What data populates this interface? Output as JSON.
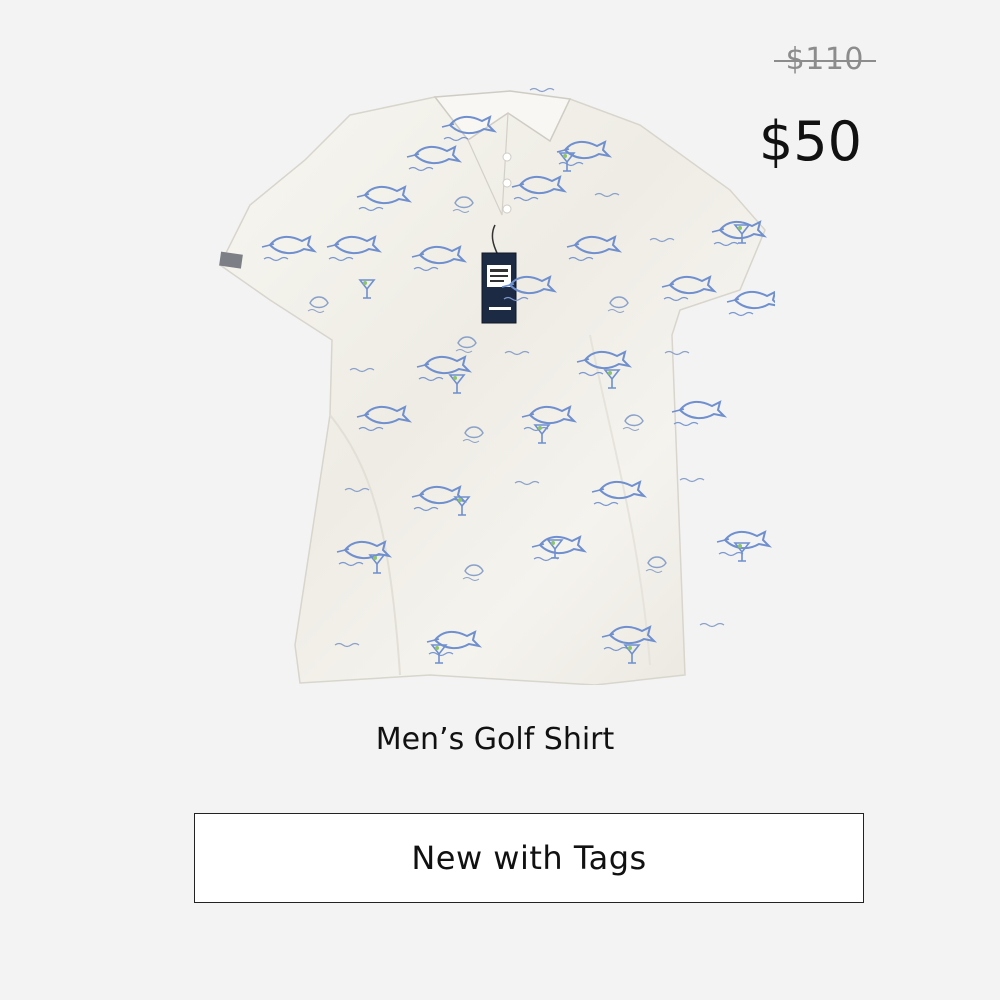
{
  "pricing": {
    "original_price": "$110",
    "sale_price": "$50"
  },
  "product": {
    "title": "Men’s Golf Shirt",
    "image_icon": "golf-shirt-icon"
  },
  "condition": {
    "label": "New with Tags"
  },
  "colors": {
    "background": "#f3f3f3",
    "shirt": "#f4f2ec",
    "print_blue": "#6f8fcf",
    "print_green": "#8cc46a",
    "text": "#111111",
    "muted_text": "#8c8c8c"
  }
}
